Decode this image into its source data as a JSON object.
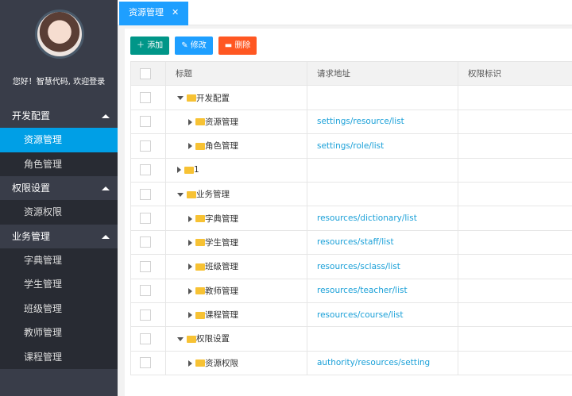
{
  "sidebar": {
    "greeting": "您好！智慧代码, 欢迎登录",
    "groups": [
      {
        "label": "开发配置",
        "items": [
          "资源管理",
          "角色管理"
        ]
      },
      {
        "label": "权限设置",
        "items": [
          "资源权限"
        ]
      },
      {
        "label": "业务管理",
        "items": [
          "字典管理",
          "学生管理",
          "班级管理",
          "教师管理",
          "课程管理"
        ]
      }
    ]
  },
  "tab": {
    "label": "资源管理",
    "close": "✕"
  },
  "toolbar": {
    "add": "添加",
    "edit": "修改",
    "delete": "删除"
  },
  "table": {
    "headers": [
      "标题",
      "请求地址",
      "权限标识"
    ],
    "rows": [
      {
        "title": "开发配置",
        "url": "",
        "perm": ""
      },
      {
        "title": "资源管理",
        "url": "settings/resource/list",
        "perm": ""
      },
      {
        "title": "角色管理",
        "url": "settings/role/list",
        "perm": ""
      },
      {
        "title": "1",
        "url": "",
        "perm": ""
      },
      {
        "title": "业务管理",
        "url": "",
        "perm": ""
      },
      {
        "title": "字典管理",
        "url": "resources/dictionary/list",
        "perm": ""
      },
      {
        "title": "学生管理",
        "url": "resources/staff/list",
        "perm": ""
      },
      {
        "title": "班级管理",
        "url": "resources/sclass/list",
        "perm": ""
      },
      {
        "title": "教师管理",
        "url": "resources/teacher/list",
        "perm": ""
      },
      {
        "title": "课程管理",
        "url": "resources/course/list",
        "perm": ""
      },
      {
        "title": "权限设置",
        "url": "",
        "perm": ""
      },
      {
        "title": "资源权限",
        "url": "authority/resources/setting",
        "perm": ""
      }
    ]
  }
}
